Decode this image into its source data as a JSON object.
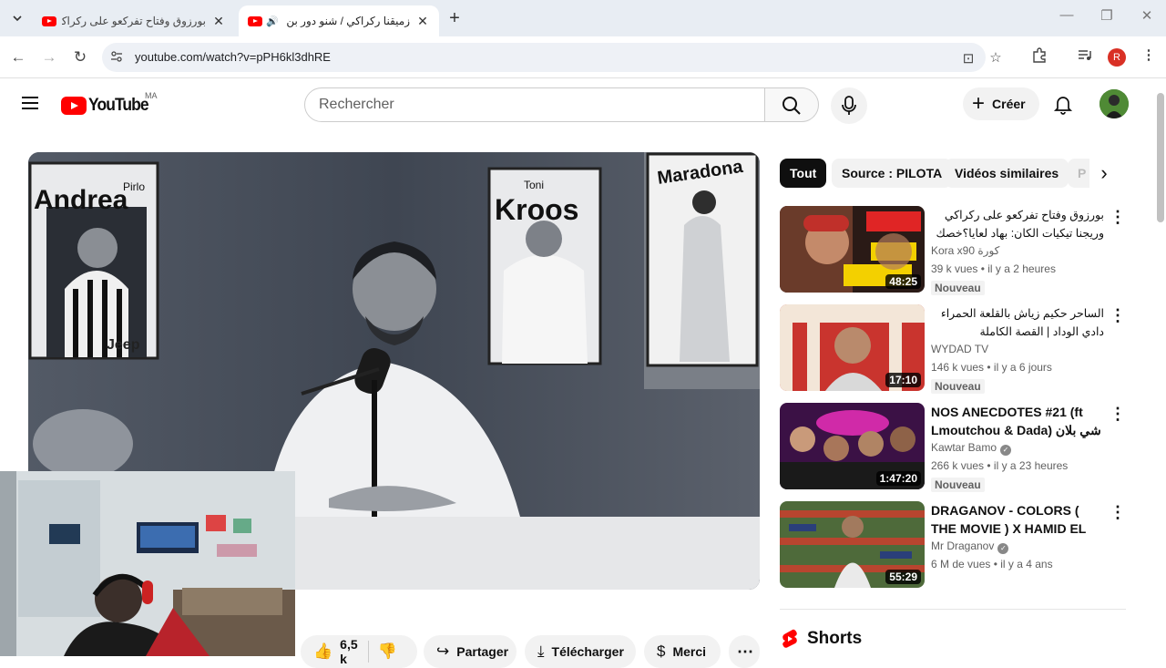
{
  "browser": {
    "tabs": [
      {
        "title": "بورزوق وفتاح تفركعو على ركراكي",
        "active": false
      },
      {
        "title": "زميقنا ركراكي / شنو دور بن ...",
        "active": true
      }
    ],
    "url": "youtube.com/watch?v=pPH6kl3dhRE",
    "profile_initial": "R"
  },
  "masthead": {
    "logo_text": "YouTube",
    "country_code": "MA",
    "search_placeholder": "Rechercher",
    "create_label": "Créer"
  },
  "chips": [
    "Tout",
    "Source : PILOTA",
    "Vidéos similaires",
    "P"
  ],
  "recommendations": [
    {
      "title": "بورزوق وفتاح تفركعو على ركراكي وريجنا تيكيات الكان: بهاد لعايا؟خصك تلعبها ضما؟",
      "rtl": true,
      "channel": "Kora x90 كورة",
      "verified": false,
      "meta": "39 k vues • il y a 2 heures",
      "badge": "Nouveau",
      "duration": "48:25"
    },
    {
      "title": "الساحر حكيم زياش بالقلعة الحمراء دادي الوداد | القصة الكاملة",
      "rtl": true,
      "channel": "WYDAD TV",
      "verified": false,
      "meta": "146 k vues • il y a 6 jours",
      "badge": "Nouveau",
      "duration": "17:10"
    },
    {
      "title": "NOS ANECDOTES #21 (ft Lmoutchou & Dada) شي بلان ما وقع",
      "rtl": false,
      "channel": "Kawtar Bamo",
      "verified": true,
      "meta": "266 k vues • il y a 23 heures",
      "badge": "Nouveau",
      "duration": "1:47:20"
    },
    {
      "title": "DRAGANOV - COLORS ( THE MOVIE ) X HAMID EL KASRI X ...",
      "rtl": false,
      "channel": "Mr Draganov",
      "verified": true,
      "meta": "6 M de vues • il y a 4 ans",
      "badge": "",
      "duration": "55:29"
    }
  ],
  "actions": {
    "like_count": "6,5 k",
    "share_label": "Partager",
    "download_label": "Télécharger",
    "thanks_label": "Merci"
  },
  "shorts_heading": "Shorts",
  "player": {
    "poster_andrea": "Andrea",
    "poster_pirlo": "Pirlo",
    "poster_toni": "Toni",
    "poster_kroos": "Kroos",
    "poster_maradona": "Maradona",
    "jersey_text": "Jeep"
  },
  "colors": {
    "brand_red": "#ff0000",
    "chip_selected": "#0f0f0f"
  }
}
